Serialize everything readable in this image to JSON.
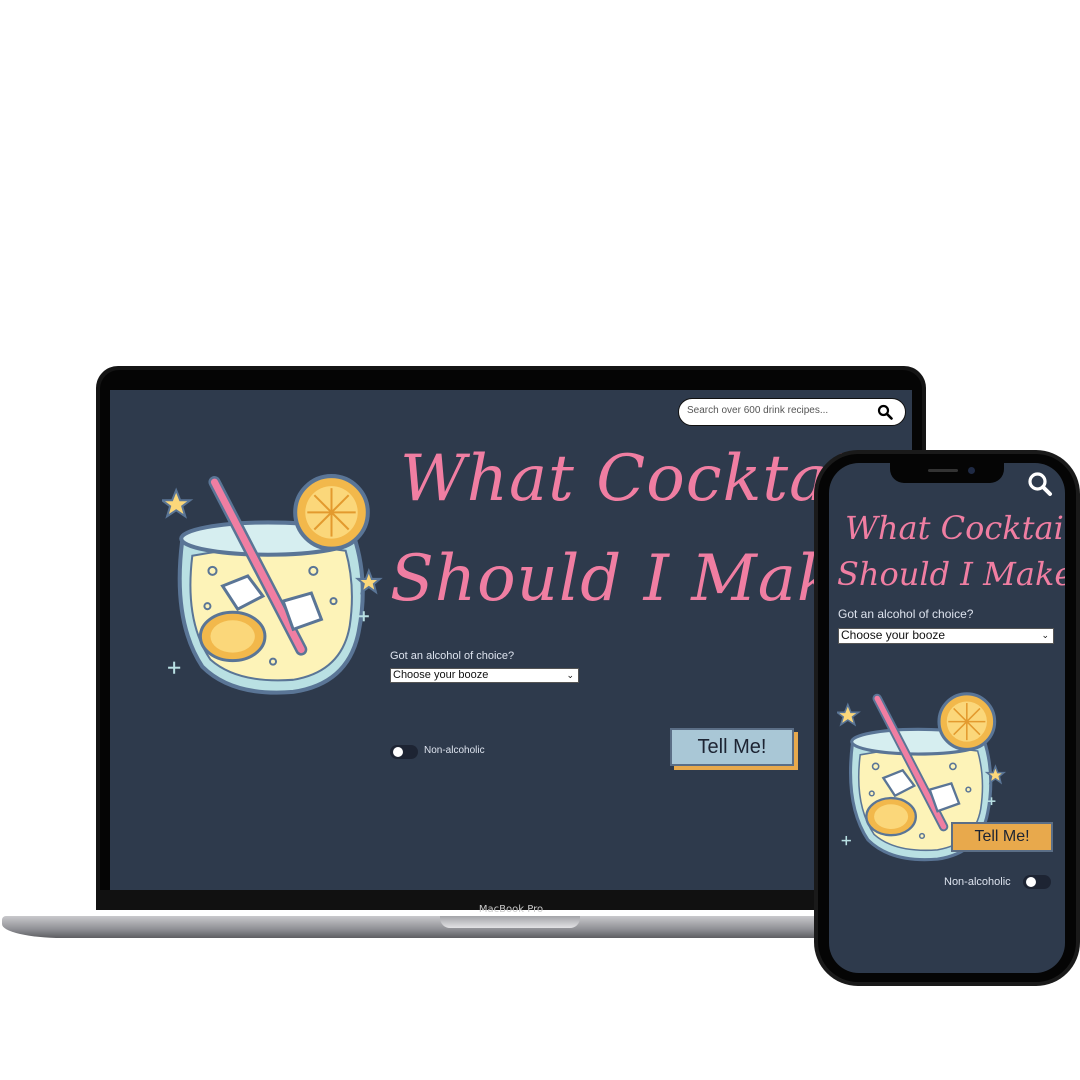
{
  "device_labels": {
    "laptop": "MacBook Pro"
  },
  "desktop": {
    "search": {
      "placeholder": "Search over 600 drink recipes..."
    },
    "title_line1": "What Cocktail",
    "title_line2": "Should I Make?",
    "alcohol_label": "Got an alcohol of choice?",
    "select_value": "Choose your booze",
    "non_alcoholic_label": "Non-alcoholic",
    "tell_me_button": "Tell Me!"
  },
  "mobile": {
    "title_line1": "What Cocktail",
    "title_line2": "Should I Make?",
    "alcohol_label": "Got an alcohol of choice?",
    "select_value": "Choose your booze",
    "tell_me_button": "Tell Me!",
    "non_alcoholic_label": "Non-alcoholic"
  },
  "colors": {
    "screen_bg": "#2e3a4c",
    "title_pink": "#f07ea2",
    "desktop_button": "#a9c7d6",
    "mobile_button": "#e8a94c",
    "button_shadow": "#e8a94c"
  },
  "toggle_state": {
    "non_alcoholic_on": false
  }
}
